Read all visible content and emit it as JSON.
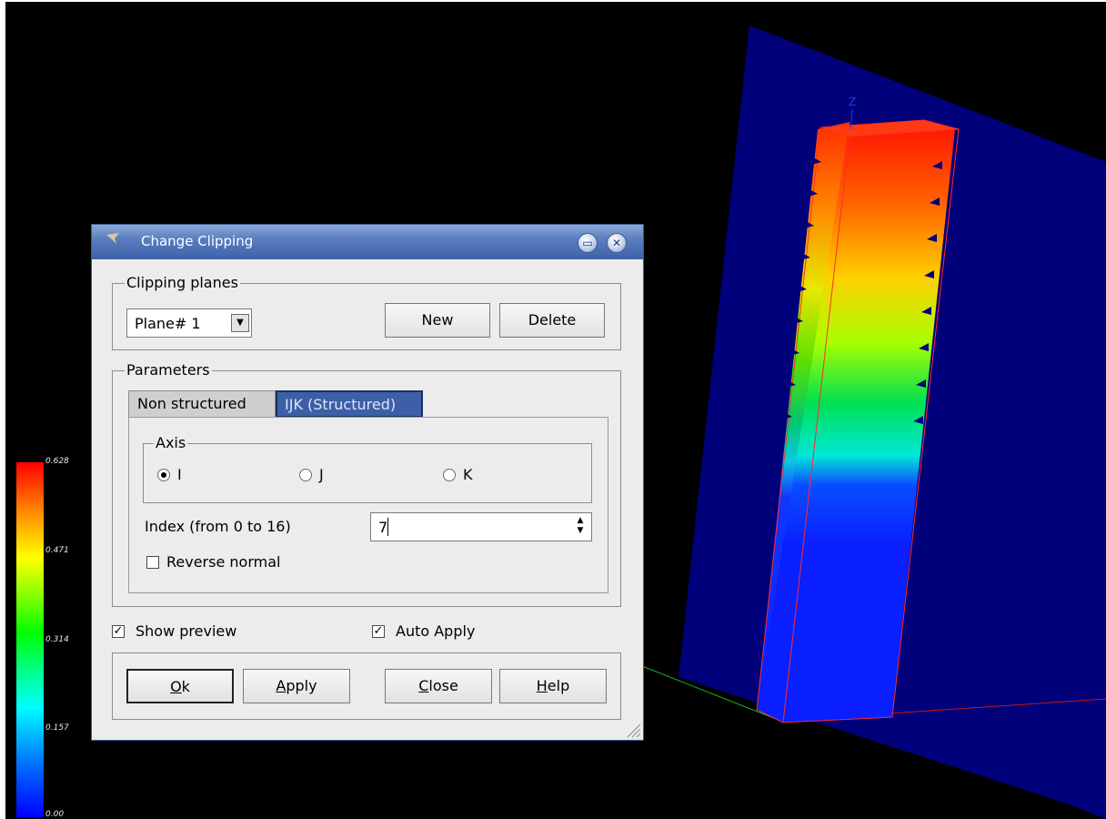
{
  "dialog": {
    "title": "Change Clipping",
    "clipping_planes": {
      "label": "Clipping planes",
      "selected_plane": "Plane# 1",
      "new_label": "New",
      "delete_label": "Delete"
    },
    "parameters": {
      "label": "Parameters",
      "tabs": [
        "Non structured",
        "IJK (Structured)"
      ],
      "active_tab": "IJK (Structured)",
      "axis": {
        "label": "Axis",
        "options": [
          "I",
          "J",
          "K"
        ],
        "selected": "I"
      },
      "index_label": "Index (from 0 to 16)",
      "index_value": "7",
      "reverse_normal_label": "Reverse normal",
      "reverse_normal_checked": false
    },
    "show_preview_label": "Show preview",
    "show_preview_checked": true,
    "auto_apply_label": "Auto Apply",
    "auto_apply_checked": true,
    "buttons": {
      "ok": {
        "mnemonic": "O",
        "rest": "k"
      },
      "apply": {
        "mnemonic": "A",
        "rest": "pply"
      },
      "close": {
        "mnemonic": "C",
        "rest": "lose"
      },
      "help": {
        "mnemonic": "H",
        "rest": "elp"
      }
    }
  },
  "scalar_bar": {
    "title": "",
    "labels": [
      "0.628",
      "0.471",
      "0.314",
      "0.157",
      "0.00"
    ]
  },
  "scene": {
    "axis_label": "Z"
  },
  "colors": {
    "background": "#000000",
    "plane": "#00007a",
    "titlebar": "#3e62a8",
    "active_tab": "#3d5fa8"
  }
}
